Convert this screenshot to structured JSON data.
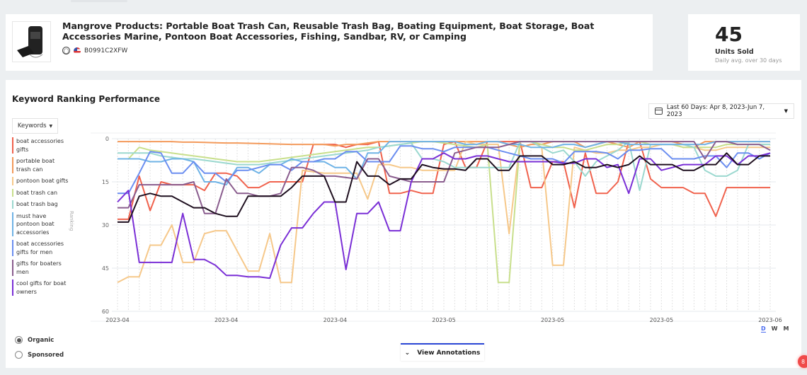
{
  "product": {
    "title": "Mangrove Products: Portable Boat Trash Can, Reusable Trash Bag, Boating Equipment, Boat Storage, Boat Accessories Marine, Pontoon Boat Accessories, Fishing, Sandbar, RV, or Camping",
    "asin": "B0991C2XFW",
    "marketplace_icon": "us-flag-icon"
  },
  "units": {
    "value": "45",
    "label": "Units Sold",
    "sub": "Daily avg. over 30 days"
  },
  "panel": {
    "title": "Keyword Ranking Performance",
    "date_range": "Last 60 Days: Apr 8, 2023-Jun 7, 2023",
    "keywords_label": "Keywords",
    "annotations_label": "View Annotations",
    "granularity": [
      "D",
      "W",
      "M"
    ],
    "granularity_selected": "D",
    "types": [
      "Organic",
      "Sponsored"
    ],
    "type_selected": "Organic"
  },
  "badge": "8",
  "chart_data": {
    "type": "line",
    "ylabel": "Ranking",
    "ylim": [
      0,
      60
    ],
    "y_inverted": true,
    "yticks": [
      0,
      15,
      30,
      45,
      60
    ],
    "x_range": [
      "2023-04-08",
      "2023-06-07"
    ],
    "xtick_labels": [
      "2023-04",
      "2023-04",
      "2023-04",
      "2023-05",
      "2023-05",
      "2023-05",
      "2023-06"
    ],
    "grid": true,
    "series": [
      {
        "name": "boat accessories gifts",
        "color": "#f0624d",
        "values": [
          28,
          28,
          13,
          25,
          15,
          16,
          16,
          16,
          18,
          12,
          12,
          13,
          17,
          17,
          15,
          15,
          15,
          15,
          2,
          2,
          2,
          3,
          2,
          2,
          1,
          19,
          19,
          18,
          19,
          19,
          2,
          1,
          10,
          10,
          1,
          1,
          1,
          1,
          17,
          17,
          8,
          8,
          24,
          5,
          19,
          19,
          15,
          1,
          1,
          14,
          17,
          17,
          17,
          19,
          19,
          27,
          17,
          17,
          17,
          17,
          17
        ]
      },
      {
        "name": "portable boat trash can",
        "color": "#f39a5b",
        "values": [
          1,
          1,
          1,
          1,
          1,
          1,
          1.2,
          1.2,
          1.3,
          1.4,
          1.5,
          1.5,
          1.6,
          1.7,
          1.8,
          1.9,
          2,
          2,
          2,
          2,
          2.5,
          2,
          2,
          1.5,
          1,
          1,
          1,
          1,
          1,
          1,
          1,
          1,
          1,
          1,
          1,
          1,
          2,
          3,
          2,
          2,
          1,
          1,
          1,
          3,
          2,
          1,
          2,
          3,
          1,
          1,
          1,
          1,
          2,
          3,
          1,
          1,
          1,
          1,
          1,
          1,
          1
        ]
      },
      {
        "name": "pontoon boat gifts",
        "color": "#f6c88a",
        "values": [
          50,
          48,
          48,
          37,
          37,
          30,
          43,
          43,
          33,
          32,
          32,
          39,
          46,
          46,
          33,
          50,
          50,
          11,
          11.5,
          12,
          12,
          12,
          12,
          21,
          9,
          9,
          10,
          10,
          11,
          11,
          11,
          11,
          1,
          2,
          2,
          2,
          33,
          1,
          1,
          3,
          44,
          44,
          3,
          4,
          5,
          5,
          4,
          4,
          3,
          3,
          2,
          2,
          3,
          3,
          4,
          4,
          3,
          3,
          3,
          3,
          3
        ]
      },
      {
        "name": "boat trash can",
        "color": "#c8df8c",
        "values": [
          7,
          7,
          3,
          4,
          4.5,
          5,
          5.5,
          6,
          6.5,
          7,
          7.5,
          8,
          8,
          8,
          7.5,
          7,
          6.5,
          6,
          5.5,
          5,
          4.5,
          4,
          3.5,
          3,
          3,
          2.5,
          2,
          1.5,
          1,
          1,
          1.5,
          2,
          2.5,
          3,
          2,
          50,
          50,
          1,
          1,
          2,
          3,
          3,
          4,
          4,
          3,
          2,
          2,
          1,
          1,
          2,
          2,
          2,
          3,
          3,
          3,
          3,
          2,
          2,
          2,
          2,
          2
        ]
      },
      {
        "name": "boat trash bag",
        "color": "#9bd8cf",
        "values": [
          5,
          5,
          5,
          5,
          6,
          6.5,
          7,
          7,
          7.5,
          8,
          8.5,
          9,
          9,
          9,
          8.5,
          8,
          7.5,
          7,
          6.5,
          6,
          5.5,
          5,
          4.5,
          4,
          3,
          2.5,
          2,
          1.5,
          7,
          7,
          8,
          10,
          10,
          10,
          10,
          10,
          10,
          1,
          1,
          3,
          5,
          4,
          8,
          13,
          8,
          6,
          4,
          1,
          18,
          2,
          2,
          2,
          2,
          3,
          11,
          13,
          13,
          11,
          2,
          2,
          2
        ]
      },
      {
        "name": "must have pontoon boat accessories",
        "color": "#6fb3e6",
        "values": [
          7,
          7,
          7,
          8,
          8,
          7,
          7,
          8,
          15,
          15,
          16,
          10,
          10,
          12,
          9,
          9,
          7,
          8,
          8,
          8,
          10,
          10,
          14,
          5,
          5,
          1,
          1,
          1,
          1,
          1,
          1,
          1,
          2,
          2,
          1,
          1,
          2,
          2,
          3,
          3,
          3,
          2,
          2,
          3,
          2,
          1,
          1,
          2,
          2,
          2,
          2,
          2,
          2,
          2,
          2,
          1,
          1,
          1,
          1,
          1,
          1
        ]
      },
      {
        "name": "boat accessories gifts for men",
        "color": "#6b8ef0",
        "values": [
          19,
          19,
          12,
          4.5,
          5,
          12,
          12,
          8,
          12,
          12,
          15,
          11,
          11,
          10,
          9,
          9,
          11,
          8,
          8,
          7,
          7,
          4.5,
          4.5,
          8,
          8,
          8,
          2.5,
          2.5,
          3.5,
          3.5,
          4.5,
          3,
          3,
          3,
          3,
          4,
          5,
          6,
          7,
          7,
          7,
          8.5,
          4.5,
          4.5,
          4.5,
          5,
          7,
          4,
          4,
          3.5,
          3.5,
          7,
          7,
          7,
          6,
          6,
          10,
          5,
          5,
          7,
          5
        ]
      },
      {
        "name": "gifts for boaters men",
        "color": "#8a5d8e",
        "values": [
          24,
          24,
          16,
          16,
          16,
          16,
          16,
          15,
          26,
          26,
          14,
          19,
          19,
          20,
          20,
          19,
          10,
          10,
          11,
          13,
          13,
          13.5,
          14,
          7,
          7,
          13,
          14,
          15,
          15,
          15,
          15,
          5,
          4,
          3,
          3,
          3,
          2,
          1,
          1,
          1,
          1,
          1,
          1,
          1,
          1,
          1,
          1,
          1,
          1,
          1,
          1,
          1,
          1,
          1,
          7,
          1,
          1,
          2,
          2,
          2,
          4
        ]
      },
      {
        "name": "cool gifts for boat owners",
        "color": "#7a2fd6",
        "values": [
          22,
          18,
          43,
          43,
          43,
          43,
          26,
          42,
          42,
          44,
          47.5,
          47.5,
          48,
          48,
          48.5,
          37,
          31,
          31,
          26,
          22,
          22,
          45.5,
          26,
          26,
          22,
          32,
          32,
          15,
          7,
          7,
          5,
          7,
          7,
          6,
          6,
          7,
          8,
          8,
          8,
          8,
          8,
          8.5,
          8.5,
          7,
          7,
          10,
          9,
          19,
          7,
          7,
          11,
          10,
          9,
          9,
          9,
          6,
          6,
          9,
          6,
          6,
          5
        ]
      },
      {
        "color": "#1e0f1f",
        "values": [
          29,
          29,
          20,
          19,
          20,
          20,
          22,
          24,
          24,
          26,
          27,
          27,
          20,
          20,
          20,
          20,
          17,
          13,
          13,
          13,
          22,
          22,
          8,
          13,
          13,
          16,
          14,
          14,
          9,
          10,
          10.5,
          10.5,
          11,
          7,
          7,
          11,
          11,
          6,
          6,
          6,
          9,
          9,
          8,
          10,
          10,
          9,
          10,
          9,
          6,
          9,
          9,
          9,
          11,
          11,
          9,
          9,
          5,
          9,
          9,
          6,
          6
        ]
      }
    ]
  }
}
